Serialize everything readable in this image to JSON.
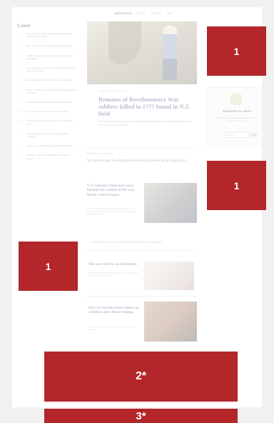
{
  "nav": {
    "items": [
      "NEWSROOM",
      "DATA",
      "TOPICS",
      "LIVE"
    ]
  },
  "latest": {
    "title": "Latest",
    "items": [
      {
        "time": "2h",
        "text": "U.S. officials expand search for missing hikers in northern forest region"
      },
      {
        "time": "3h",
        "text": "New rules for electric vehicle credits announced"
      },
      {
        "time": "3h",
        "text": "Wildfire smoke drifts across three states as crews battle blaze"
      },
      {
        "time": "4h",
        "text": "Court hears arguments on voting districts and new maps in the south"
      },
      {
        "time": "5h",
        "text": "Historic bridge reopens after two-year restoration"
      },
      {
        "time": "6h",
        "text": "Markets steady as investors await jobs data from the Labor Dept."
      },
      {
        "time": "7h",
        "text": "Scientists track rare bird sighting near the coast"
      },
      {
        "time": "8h",
        "text": "City council votes on new budget for schools"
      },
      {
        "time": "9h",
        "text": "Storm warnings issued for parts of the plains this week"
      },
      {
        "time": "10h",
        "text": "Farmers adapt to drought with new irrigation methods"
      },
      {
        "time": "11h",
        "text": "Museum unveils exhibit on early American history"
      },
      {
        "time": "12h",
        "text": "Officials review safety plans ahead of summer season"
      }
    ]
  },
  "hero": {
    "kicker": "AMERICAN REVOLUTION",
    "title": "Remains of Revolutionary War soldiers killed in 1777 found in N.J. field",
    "text": "Archaeologists say the remains were found during a survey of a historic battlefield site in New Jersey, where troops clashed."
  },
  "section": {
    "kicker": "RELATED COVERAGE",
    "title": "Six months ago, the highest-stakes hearing ahead of the high court"
  },
  "cards": [
    {
      "title": "U.S. veteran, whose face once became the symbol of his war, finally returns home",
      "text": "The retired soldier was honored in a ceremony as family members gathered to welcome him back after decades abroad."
    },
    {
      "title": "The new shift in an old market",
      "text": "Researchers say changing habits are reshaping how families shop and cook."
    },
    {
      "title": "How to read the latest report on wildfires and climate change",
      "text": "A closer look at the numbers behind this year's fire season."
    }
  ],
  "related_link": "Related: how a war photo became an iconic moment for a generation",
  "widget": {
    "title": "Subscribe to alerts",
    "text": "Get the latest breaking news delivered to your inbox each morning.",
    "select": "Select one",
    "go": "Go"
  },
  "ads": {
    "a": "1",
    "b": "1",
    "c": "1",
    "d": "2*",
    "e": "3*"
  }
}
